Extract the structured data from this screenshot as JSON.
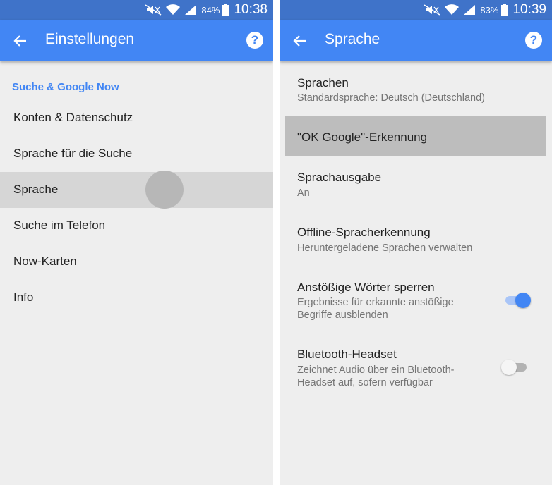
{
  "left": {
    "status": {
      "battery": "84%",
      "time": "10:38"
    },
    "toolbar": {
      "title": "Einstellungen",
      "help": "?"
    },
    "section": "Suche & Google Now",
    "items": [
      {
        "label": "Konten & Datenschutz"
      },
      {
        "label": "Sprache für die Suche"
      },
      {
        "label": "Sprache",
        "pressed": true
      },
      {
        "label": "Suche im Telefon"
      },
      {
        "label": "Now-Karten"
      },
      {
        "label": "Info"
      }
    ]
  },
  "right": {
    "status": {
      "battery": "83%",
      "time": "10:39"
    },
    "toolbar": {
      "title": "Sprache",
      "help": "?"
    },
    "prefs": [
      {
        "title": "Sprachen",
        "summary": "Standardsprache: Deutsch (Deutschland)"
      },
      {
        "title": "\"OK Google\"-Erkennung",
        "summary": "",
        "highlighted": true
      },
      {
        "title": "Sprachausgabe",
        "summary": "An"
      },
      {
        "title": "Offline-Spracherkennung",
        "summary": "Heruntergeladene Sprachen verwalten"
      },
      {
        "title": "Anstößige Wörter sperren",
        "summary": "Ergebnisse für erkannte anstößige Begriffe ausblenden",
        "switch": "on"
      },
      {
        "title": "Bluetooth-Headset",
        "summary": "Zeichnet Audio über ein Bluetooth-Headset auf, sofern verfügbar",
        "switch": "off"
      }
    ]
  },
  "icons": {
    "back": "arrow-back-icon",
    "help": "help-circle-icon",
    "mute": "mute-icon",
    "wifi": "wifi-icon",
    "signal": "signal-icon",
    "battery": "battery-icon"
  },
  "colors": {
    "status_bar": "#3f73c9",
    "app_bar": "#4286f4",
    "accent": "#4286f4",
    "background": "#eeeeee",
    "pressed": "#d6d6d6",
    "highlight": "#bdbdbd"
  }
}
